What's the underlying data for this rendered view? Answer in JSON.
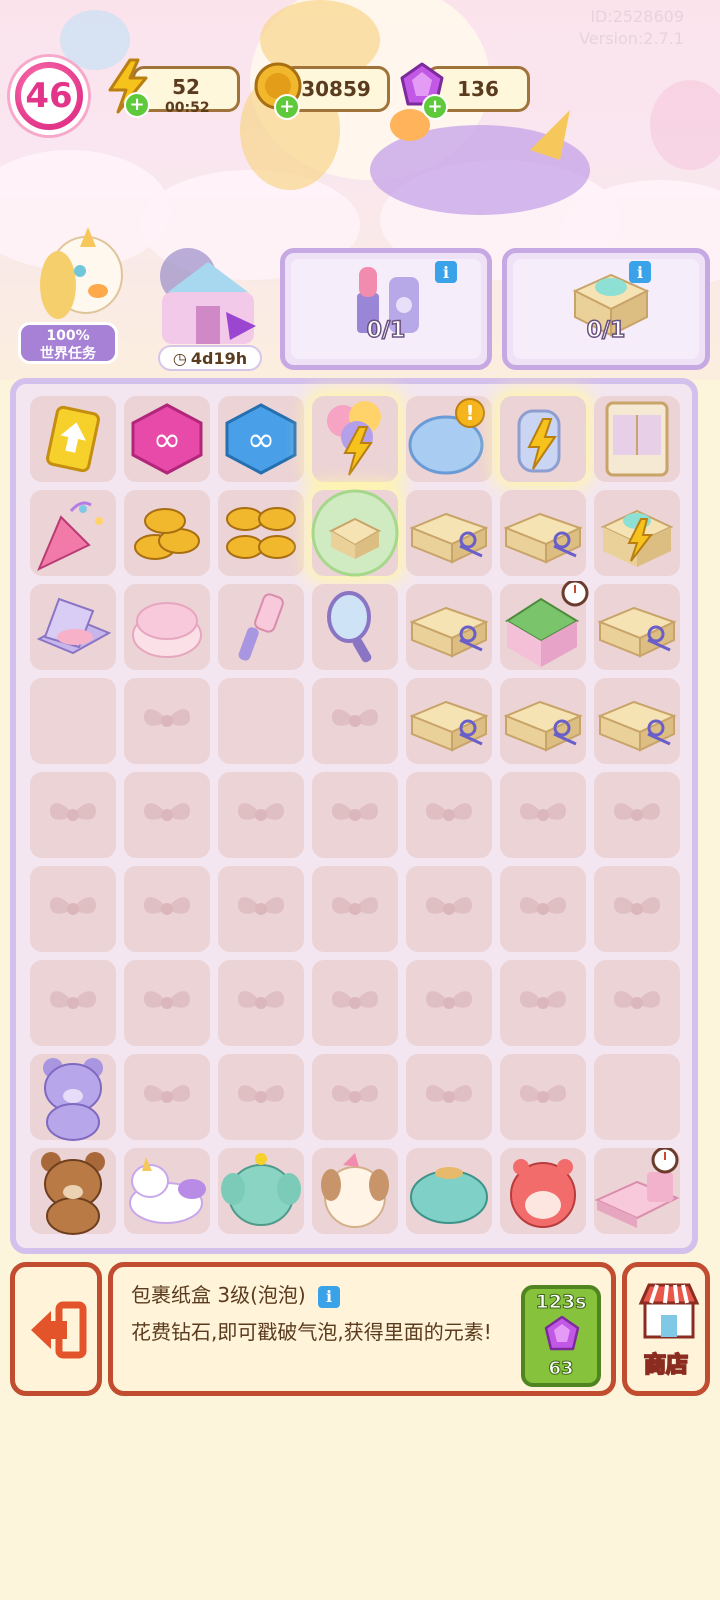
{
  "header": {
    "player_id": "ID:2528609",
    "version": "Version:2.7.1",
    "level": "46",
    "energy": {
      "value": "52",
      "timer": "00:52"
    },
    "coins": "30859",
    "gems": "136"
  },
  "side": {
    "world_task": {
      "percent": "100%",
      "label": "世界任务"
    },
    "event_timer": "4d19h"
  },
  "orders": [
    {
      "name": "lipstick-and-nailpolish",
      "count": "0/1"
    },
    {
      "name": "gift-box",
      "count": "0/1"
    }
  ],
  "board": {
    "rows": [
      [
        "arrow-card",
        "infinity-pink",
        "infinity-blue",
        "balloons-energy",
        "fishbowl-alert",
        "jar-energy",
        "wardrobe"
      ],
      [
        "party-popper",
        "coin-stack-small",
        "coin-stack-large",
        "bubble-box",
        "parcel-box",
        "parcel-box",
        "giftbox-energy"
      ],
      [
        "compact",
        "powder-puff",
        "lint-roller",
        "hand-mirror",
        "parcel-box",
        "house-timer",
        "parcel-box"
      ],
      [
        "empty",
        "locked",
        "empty",
        "locked",
        "parcel-box",
        "parcel-box",
        "parcel-box"
      ],
      [
        "locked",
        "locked",
        "locked",
        "locked",
        "locked",
        "locked",
        "locked"
      ],
      [
        "locked",
        "locked",
        "locked",
        "locked",
        "locked",
        "locked",
        "locked"
      ],
      [
        "locked",
        "locked",
        "locked",
        "locked",
        "locked",
        "locked",
        "locked"
      ],
      [
        "purple-bear",
        "locked",
        "locked",
        "locked",
        "locked",
        "locked",
        "empty"
      ],
      [
        "brown-bear",
        "unicorn-plush",
        "elephant-plush",
        "puppy-plush",
        "seal-plush",
        "hamster-plush",
        "bed-timer"
      ]
    ]
  },
  "info_panel": {
    "title": "包裹纸盒 3级(泡泡)",
    "description": "花费钻石,即可戳破气泡,获得里面的元素!",
    "timer": "123s",
    "cost": "63"
  },
  "shop_label": "商店",
  "colors": {
    "accent_pink": "#e2358a",
    "panel_border": "#c14c30",
    "board_border": "#d4c0ec",
    "buy_green": "#87c23c"
  }
}
